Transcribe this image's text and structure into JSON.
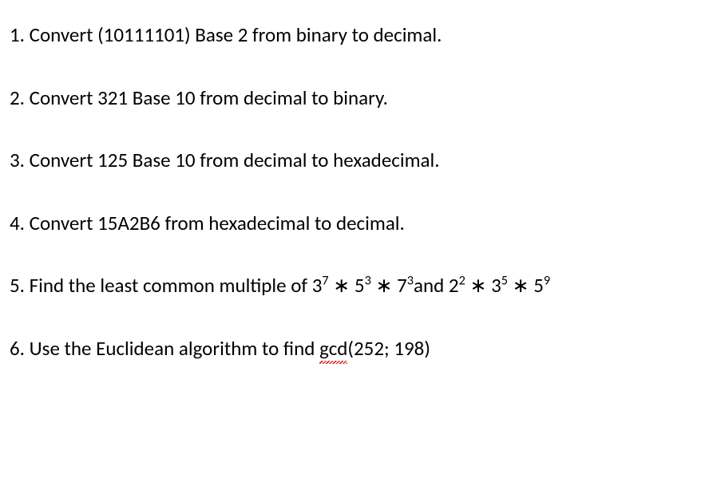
{
  "questions": {
    "q1": {
      "number": "1.",
      "text": "Convert (10111101) Base 2 from binary to decimal."
    },
    "q2": {
      "number": "2.",
      "text": "Convert 321 Base 10 from decimal to binary."
    },
    "q3": {
      "number": "3.",
      "text": "Convert 125 Base 10 from decimal to hexadecimal."
    },
    "q4": {
      "number": "4.",
      "text": "Convert 15A2B6 from hexadecimal to decimal."
    },
    "q5": {
      "number": "5.",
      "prefix": "Find the least common multiple of 3",
      "exp1": "7",
      "mid1": " ∗ 5",
      "exp2": "3",
      "mid2": " ∗ 7",
      "exp3": "3",
      "mid3": "and 2",
      "exp4": "2",
      "mid4": " ∗ 3",
      "exp5": "5",
      "mid5": " ∗ 5",
      "exp6": "9"
    },
    "q6": {
      "number": "6.",
      "prefix": "Use the Euclidean algorithm to find ",
      "gcd_word": "gcd",
      "suffix": "(252; 198)"
    }
  }
}
